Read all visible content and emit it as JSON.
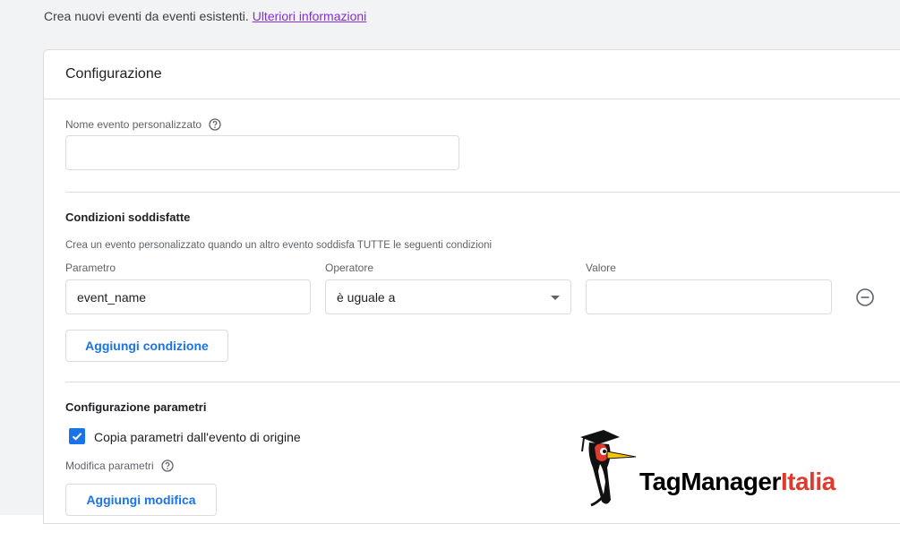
{
  "intro": {
    "text": "Crea nuovi eventi da eventi esistenti.",
    "link": "Ulteriori informazioni"
  },
  "card": {
    "title": "Configurazione",
    "custom_event": {
      "label": "Nome evento personalizzato",
      "value": ""
    },
    "conditions": {
      "title": "Condizioni soddisfatte",
      "hint": "Crea un evento personalizzato quando un altro evento soddisfa TUTTE le seguenti condizioni",
      "columns": {
        "parameter": "Parametro",
        "operator": "Operatore",
        "value": "Valore"
      },
      "row": {
        "parameter": "event_name",
        "operator": "è uguale a",
        "value": ""
      },
      "add_button": "Aggiungi condizione"
    },
    "parameters": {
      "title": "Configurazione parametri",
      "copy_checkbox": {
        "label": "Copia parametri dall'evento di origine",
        "checked": true
      },
      "modify_label": "Modifica parametri",
      "add_button": "Aggiungi modifica"
    }
  },
  "logo": {
    "brand_main": "TagManager",
    "brand_accent": "Italia"
  },
  "colors": {
    "accent_blue": "#1a73e8",
    "link_purple": "#8430ce",
    "brand_red": "#e03a2f"
  }
}
